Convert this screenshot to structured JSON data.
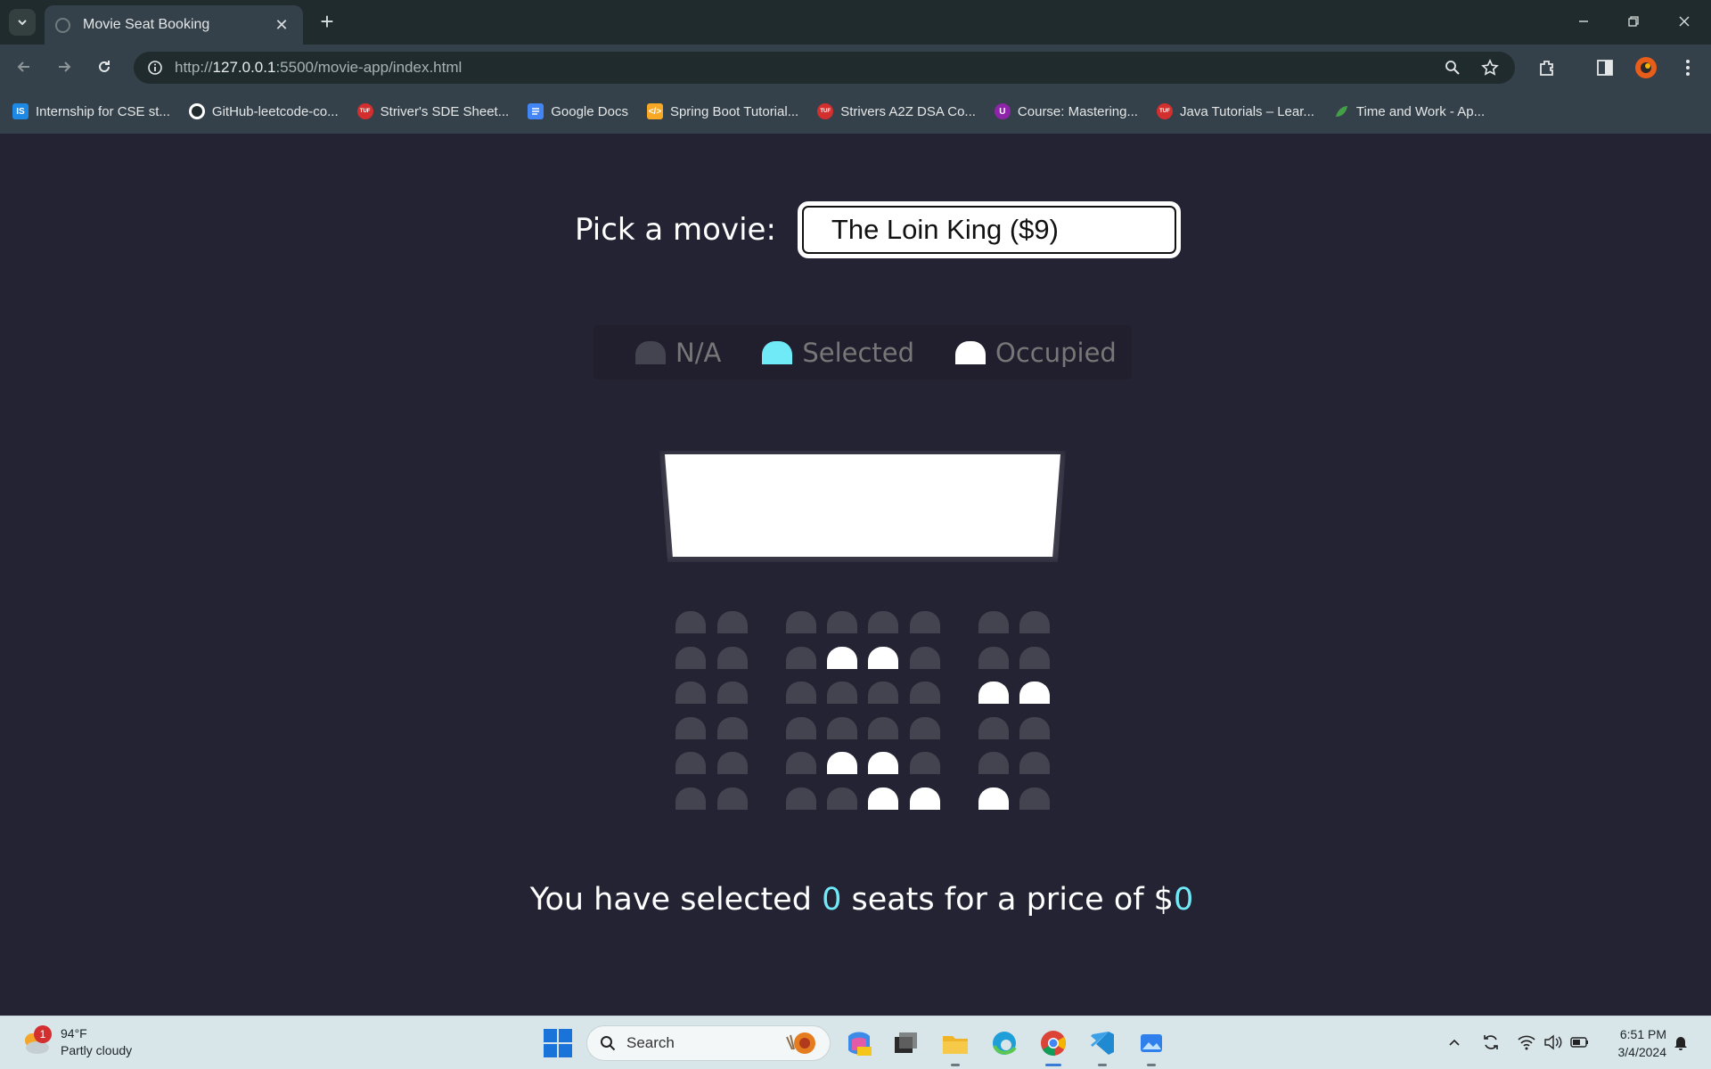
{
  "browser": {
    "tab_title": "Movie Seat Booking",
    "url_prefix": "http://",
    "url_host": "127.0.0.1",
    "url_path": ":5500/movie-app/index.html",
    "bookmarks": [
      {
        "label": "Internship for CSE st...",
        "icon": "IS",
        "color": "#1e88e5"
      },
      {
        "label": "GitHub-leetcode-co...",
        "icon": "github",
        "color": "#ffffff"
      },
      {
        "label": "Striver's SDE Sheet...",
        "icon": "TUF",
        "color": "#d32f2f"
      },
      {
        "label": "Google Docs",
        "icon": "docs",
        "color": "#4285f4"
      },
      {
        "label": "Spring Boot Tutorial...",
        "icon": "</>",
        "color": "#f9a825"
      },
      {
        "label": "Strivers A2Z DSA Co...",
        "icon": "TUF",
        "color": "#d32f2f"
      },
      {
        "label": "Course: Mastering...",
        "icon": "U",
        "color": "#8e24aa"
      },
      {
        "label": "Java Tutorials – Lear...",
        "icon": "TUF",
        "color": "#d32f2f"
      },
      {
        "label": "Time and Work - Ap...",
        "icon": "leaf",
        "color": "#43a047"
      }
    ]
  },
  "page": {
    "picker_label": "Pick a movie:",
    "selected_movie": "The Loin King ($9)",
    "legend": [
      {
        "label": "N/A",
        "color": "#444451"
      },
      {
        "label": "Selected",
        "color": "#6feaf6"
      },
      {
        "label": "Occupied",
        "color": "#ffffff"
      }
    ],
    "seat_rows": [
      [
        "na",
        "na",
        "na",
        "na",
        "na",
        "na",
        "na",
        "na"
      ],
      [
        "na",
        "na",
        "na",
        "occupied",
        "occupied",
        "na",
        "na",
        "na"
      ],
      [
        "na",
        "na",
        "na",
        "na",
        "na",
        "na",
        "occupied",
        "occupied"
      ],
      [
        "na",
        "na",
        "na",
        "na",
        "na",
        "na",
        "na",
        "na"
      ],
      [
        "na",
        "na",
        "na",
        "occupied",
        "occupied",
        "na",
        "na",
        "na"
      ],
      [
        "na",
        "na",
        "na",
        "na",
        "occupied",
        "occupied",
        "occupied",
        "na"
      ]
    ],
    "summary": {
      "part1": "You have selected ",
      "count": "0",
      "part2": " seats for a price of $",
      "total": "0"
    }
  },
  "taskbar": {
    "weather_temp": "94°F",
    "weather_desc": "Partly cloudy",
    "weather_badge": "1",
    "search_placeholder": "Search",
    "time": "6:51 PM",
    "date": "3/4/2024"
  }
}
